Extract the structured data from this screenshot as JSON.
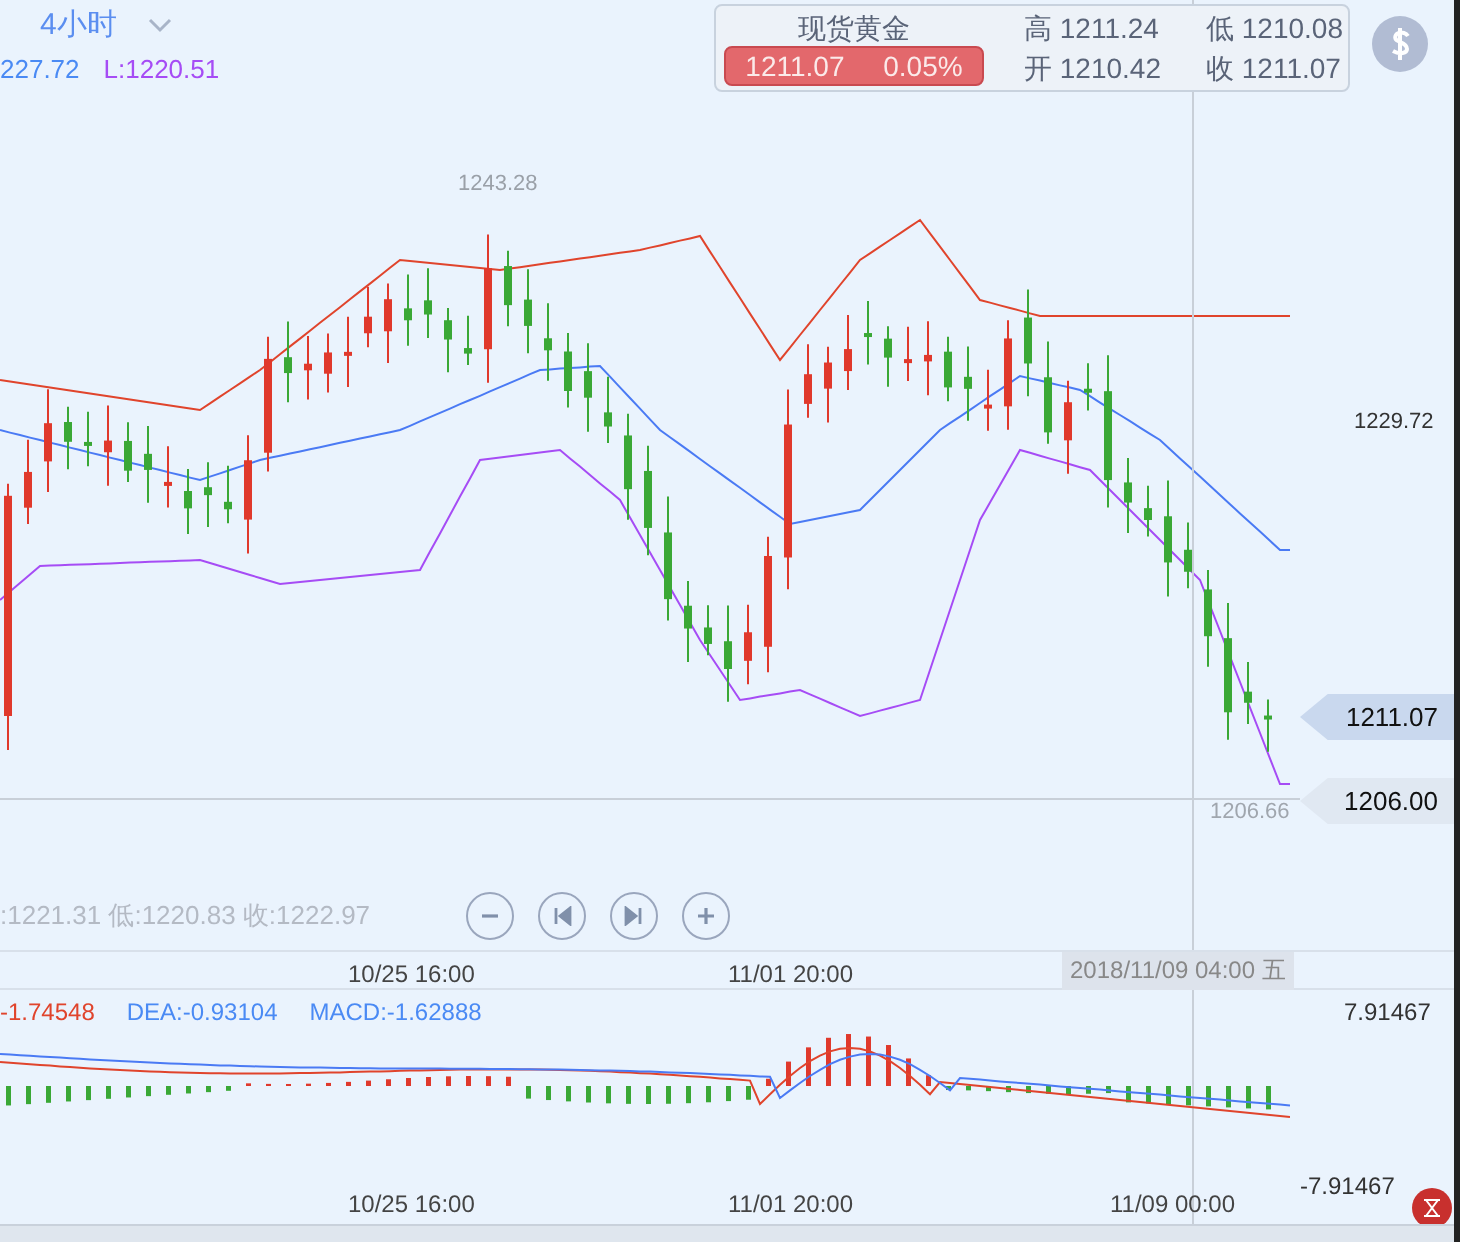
{
  "header": {
    "period": "4小时",
    "legend": [
      {
        "text": "227.72",
        "color": "#4a8af4"
      },
      {
        "text": "L:1220.51",
        "color": "#a64cf5"
      }
    ]
  },
  "quote": {
    "name": "现货黄金",
    "price": "1211.07",
    "change": "0.05%",
    "stats": [
      {
        "label": "高",
        "value": "1211.24"
      },
      {
        "label": "低",
        "value": "1210.08"
      },
      {
        "label": "开",
        "value": "1210.42"
      },
      {
        "label": "收",
        "value": "1211.07"
      }
    ]
  },
  "main_chart": {
    "peak_label": "1243.28",
    "low_label": "1206.66",
    "axis_label": "1229.72",
    "last_price_tag": "1211.07",
    "cursor_price_tag": "1206.00"
  },
  "ohlc_line": ":1221.31 低:1220.83 收:1222.97",
  "time_axis": {
    "labels": [
      "10/25 16:00",
      "11/01 20:00"
    ],
    "cursor": "2018/11/09 04:00 五"
  },
  "macd": {
    "legend": [
      {
        "text": "-1.74548",
        "color": "#e0442c"
      },
      {
        "text": "DEA:-0.93104",
        "color": "#4a8af4"
      },
      {
        "text": "MACD:-1.62888",
        "color": "#4a8af4"
      }
    ],
    "max": "7.91467",
    "min": "-7.91467"
  },
  "bottom_axis": [
    "10/25 16:00",
    "11/01 20:00",
    "11/09 00:00"
  ]
}
